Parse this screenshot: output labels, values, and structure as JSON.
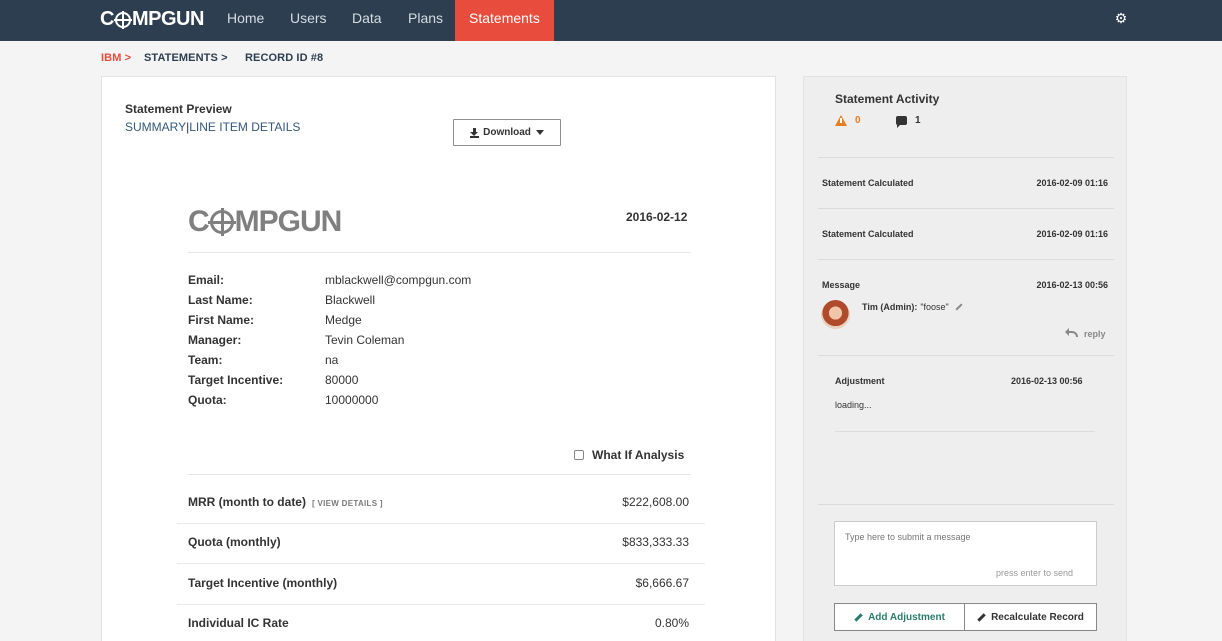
{
  "nav": {
    "brand_pre": "C",
    "brand_post": "MPGUN",
    "items": [
      "Home",
      "Users",
      "Data",
      "Plans",
      "Statements"
    ],
    "active": "Statements",
    "settings_icon": "gear-icon"
  },
  "breadcrumb": {
    "client": "IBM",
    "section": "STATEMENTS",
    "record": "RECORD ID #8",
    "separator": ">"
  },
  "preview": {
    "title": "Statement Preview",
    "tab_summary": "SUMMARY",
    "tab_separator": "|",
    "tab_line_items": "LINE ITEM DETAILS",
    "download_label": "Download",
    "logo_pre": "C",
    "logo_post": "MPGUN",
    "date": "2016-02-12",
    "info": [
      {
        "label": "Email:",
        "value": "mblackwell@compgun.com"
      },
      {
        "label": "Last Name:",
        "value": "Blackwell"
      },
      {
        "label": "First Name:",
        "value": "Medge"
      },
      {
        "label": "Manager:",
        "value": "Tevin Coleman"
      },
      {
        "label": "Team:",
        "value": "na"
      },
      {
        "label": "Target Incentive:",
        "value": "80000"
      },
      {
        "label": "Quota:",
        "value": "10000000"
      }
    ],
    "what_if_label": "What If Analysis",
    "what_if_checked": false,
    "view_details": "[ VIEW DETAILS ]",
    "metrics": [
      {
        "label": "MRR (month to date)",
        "value": "$222,608.00"
      },
      {
        "label": "Quota (monthly)",
        "value": "$833,333.33"
      },
      {
        "label": "Target Incentive (monthly)",
        "value": "$6,666.67"
      },
      {
        "label": "Individual IC Rate",
        "value": "0.80%"
      }
    ]
  },
  "activity": {
    "title": "Statement Activity",
    "warnings": "0",
    "comments": "1",
    "warning_color": "#e67e22",
    "events": [
      {
        "label": "Statement Calculated",
        "time": "2016-02-09 01:16"
      },
      {
        "label": "Statement Calculated",
        "time": "2016-02-09 01:16"
      },
      {
        "label": "Message",
        "time": "2016-02-13 00:56"
      }
    ],
    "message": {
      "author": "Tim (Admin):",
      "text": "\"foose\"",
      "reply_label": "reply"
    },
    "adjustment": {
      "label": "Adjustment",
      "time": "2016-02-13 00:56",
      "status": "loading..."
    },
    "input_placeholder": "Type here to submit a message",
    "input_hint": "press enter to send",
    "add_adjustment_label": "Add Adjustment",
    "recalculate_label": "Recalculate Record"
  },
  "colors": {
    "navbar": "#2c3e50",
    "accent": "#e74c3c",
    "link": "#34587a",
    "add_button": "#2a7d6e"
  }
}
